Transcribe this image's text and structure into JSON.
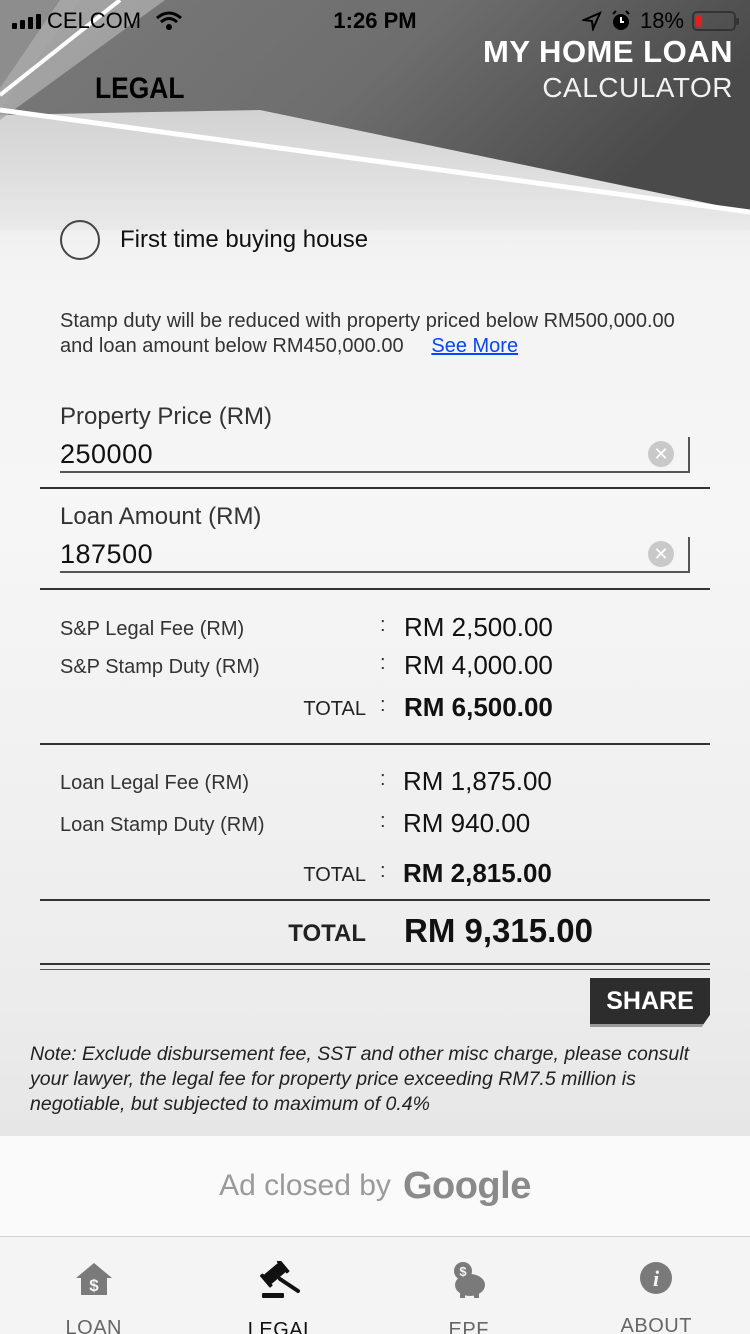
{
  "status_bar": {
    "carrier": "CELCOM",
    "time": "1:26 PM",
    "battery": "18%",
    "battery_level": 0.18
  },
  "header": {
    "app_title_line1": "MY HOME LOAN",
    "app_title_line2": "CALCULATOR",
    "page_title": "LEGAL"
  },
  "first_time_buyer": {
    "label": "First time buying house",
    "checked": false
  },
  "stamp_note": {
    "text": "Stamp duty will be reduced with property priced below RM500,000.00 and loan amount below RM450,000.00",
    "link": "See More"
  },
  "property_price": {
    "label": "Property Price (RM)",
    "value": "250000"
  },
  "loan_amount": {
    "label": "Loan Amount (RM)",
    "value": "187500"
  },
  "sp_section": {
    "legal_fee_label": "S&P Legal Fee (RM)",
    "legal_fee_value": "RM 2,500.00",
    "stamp_duty_label": "S&P Stamp Duty (RM)",
    "stamp_duty_value": "RM 4,000.00",
    "total_label": "TOTAL",
    "total_value": "RM 6,500.00"
  },
  "loan_section": {
    "legal_fee_label": "Loan Legal Fee (RM)",
    "legal_fee_value": "RM 1,875.00",
    "stamp_duty_label": "Loan Stamp Duty (RM)",
    "stamp_duty_value": "RM 940.00",
    "total_label": "TOTAL",
    "total_value": "RM 2,815.00"
  },
  "grand_total": {
    "label": "TOTAL",
    "value": "RM 9,315.00"
  },
  "colon": ":",
  "share_label": "SHARE",
  "footnote": "Note: Exclude disbursement fee, SST and other misc charge, please consult your lawyer, the legal fee for property price exceeding RM7.5 million is negotiable, but subjected to maximum of 0.4%",
  "ad": {
    "text": "Ad closed by",
    "brand": "Google"
  },
  "tabs": [
    {
      "label": "LOAN",
      "icon": "house-dollar-icon",
      "active": false
    },
    {
      "label": "LEGAL",
      "icon": "gavel-icon",
      "active": true
    },
    {
      "label": "EPF",
      "icon": "piggy-bank-icon",
      "active": false
    },
    {
      "label": "ABOUT",
      "icon": "info-icon",
      "active": false
    }
  ]
}
